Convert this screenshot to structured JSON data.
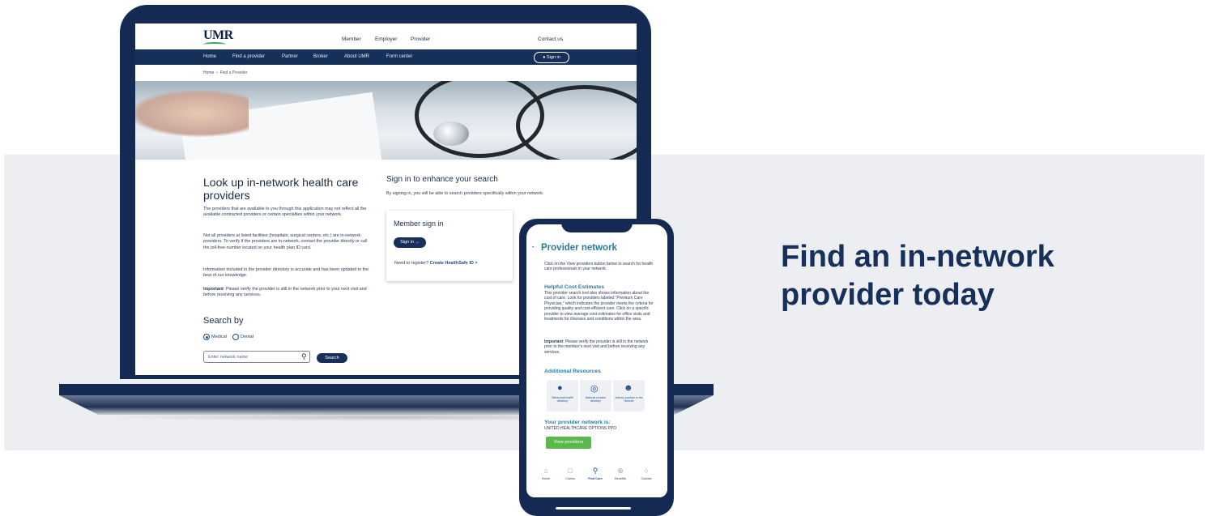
{
  "tagline": "Find an in-network provider today",
  "laptop_site": {
    "logo": "UMR",
    "top_nav": [
      "Member",
      "Employer",
      "Provider"
    ],
    "contact": "Contact us",
    "main_nav": [
      "Home",
      "Find a provider",
      "Partner",
      "Broker",
      "About UMR",
      "Form center"
    ],
    "signin_label": "Sign in",
    "breadcrumb": {
      "home": "Home",
      "separator": "›",
      "current": "Find a Provider"
    },
    "lookup": {
      "heading": "Look up in-network health care providers",
      "para1": "The providers that are available to you through this application may not reflect all the available contracted providers or certain specialties within your network.",
      "para2": "Not all providers at listed facilities (hospitals, surgical centers, etc.) are in-network providers. To verify if the providers are in-network, contact the provider directly or call the toll-free number located on your health plan ID card.",
      "para3": "Information included in the provider directory is accurate and has been updated to the best of our knowledge.",
      "para4_bold": "Important",
      "para4_rest": ": Please verify the provider is still in the network prior to your next visit and before receiving any services."
    },
    "search_by": {
      "heading": "Search by",
      "options": [
        "Medical",
        "Dental"
      ],
      "selected": "Medical",
      "input_placeholder": "Enter network name",
      "button": "Search"
    },
    "signin_section": {
      "heading": "Sign in to enhance your search",
      "desc": "By signing in, you will be able to search providers specifically within your network.",
      "card_title": "Member sign in",
      "card_button": "Sign in →",
      "register_text": "Need to register?",
      "register_link": "Create HealthSafe ID >"
    }
  },
  "phone_app": {
    "title": "Provider network",
    "intro": "Click on the View providers button below to search for health care professionals in your network.",
    "cost_heading": "Helpful Cost Estimates",
    "cost_text": "This provider search tool also shows information about the cost of care. Look for providers labeled \"Premium Care Physician,\" which indicates the provider meets the criteria for providing quality and cost-efficient care. Click on a specific provider to view average cost estimates for office visits and treatments for illnesses and conditions within the area.",
    "important_bold": "Important",
    "important_rest": ": Please verify the provider is still in the network prior to the member's next visit and before receiving any services.",
    "resources_heading": "Additional Resources",
    "resources": [
      {
        "label": "Behavioral health directory",
        "icon": "brain-icon"
      },
      {
        "label": "National vendors directory",
        "icon": "globe-icon"
      },
      {
        "label": "Add my provider to the network",
        "icon": "add-provider-icon"
      }
    ],
    "network_heading": "Your provider network is:",
    "network_name": "UNITED HEALTHCARE OPTIONS PPO",
    "view_button": "View providers",
    "tabs": [
      {
        "label": "Home",
        "icon": "home-icon"
      },
      {
        "label": "Claims",
        "icon": "claims-icon"
      },
      {
        "label": "Find Care",
        "icon": "search-icon"
      },
      {
        "label": "Benefits",
        "icon": "benefits-icon"
      },
      {
        "label": "Contact",
        "icon": "chat-icon"
      }
    ],
    "active_tab": "Find Care"
  },
  "colors": {
    "navy": "#16305a",
    "teal": "#2a7d9d",
    "green": "#5bb84d",
    "band": "#eceef1"
  }
}
